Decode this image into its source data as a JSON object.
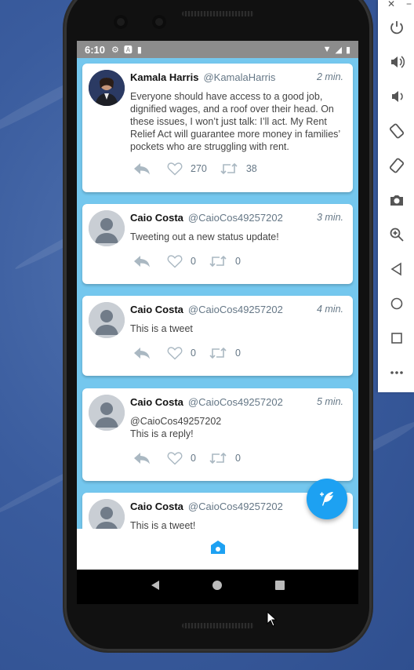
{
  "status_bar": {
    "time": "6:10"
  },
  "tweets": [
    {
      "name": "Kamala Harris",
      "handle": "@KamalaHarris",
      "time": "2 min.",
      "text": "Everyone should have access to a good job, dignified wages, and a roof over their head. On these issues, I won’t just talk: I’ll act. My Rent Relief Act will guarantee more money in families’ pockets who are struggling with rent.",
      "likes": "270",
      "retweets": "38"
    },
    {
      "name": "Caio Costa",
      "handle": "@CaioCos49257202",
      "time": "3 min.",
      "text": "Tweeting out a new status update!",
      "likes": "0",
      "retweets": "0"
    },
    {
      "name": "Caio Costa",
      "handle": "@CaioCos49257202",
      "time": "4 min.",
      "text": "This is a tweet",
      "likes": "0",
      "retweets": "0"
    },
    {
      "name": "Caio Costa",
      "handle": "@CaioCos49257202",
      "time": "5 min.",
      "text_line1": "@CaioCos49257202",
      "text_line2": "This is a reply!",
      "likes": "0",
      "retweets": "0"
    },
    {
      "name": "Caio Costa",
      "handle": "@CaioCos49257202",
      "time": "",
      "text": "This is a tweet!"
    }
  ],
  "icons": {
    "reply": "reply-icon",
    "like": "heart-icon",
    "retweet": "retweet-icon",
    "compose": "feather-icon",
    "home": "home-icon"
  },
  "colors": {
    "accent": "#1da1f2",
    "feed_background": "#74c7ee",
    "icon_gray": "#aab8c2"
  },
  "emulator_controls": [
    "power",
    "volume-up",
    "volume-down",
    "rotate-left",
    "rotate-right",
    "screenshot",
    "zoom",
    "back",
    "home",
    "overview",
    "more"
  ]
}
